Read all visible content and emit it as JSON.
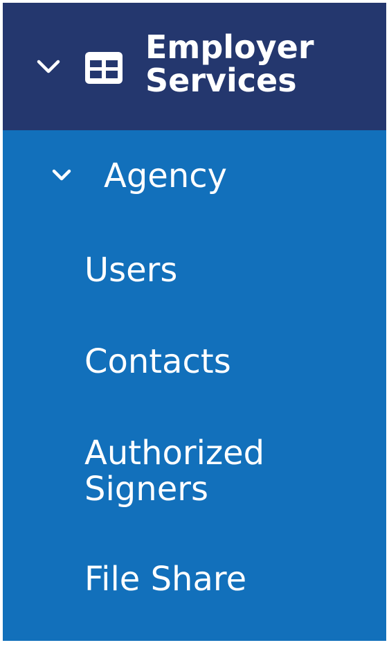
{
  "nav": {
    "section": {
      "title_line1": "Employer",
      "title_line2": "Services",
      "chevron_icon": "chevron-down-icon",
      "section_icon": "table-icon",
      "expanded": true
    },
    "group": {
      "label": "Agency",
      "chevron_icon": "chevron-down-icon",
      "expanded": true
    },
    "items": [
      {
        "label": "Users"
      },
      {
        "label": "Contacts"
      },
      {
        "label_line1": "Authorized",
        "label_line2": "Signers"
      },
      {
        "label": "File Share"
      }
    ]
  },
  "colors": {
    "header_bg": "#24376e",
    "nav_bg": "#1270bb",
    "text": "#ffffff"
  }
}
